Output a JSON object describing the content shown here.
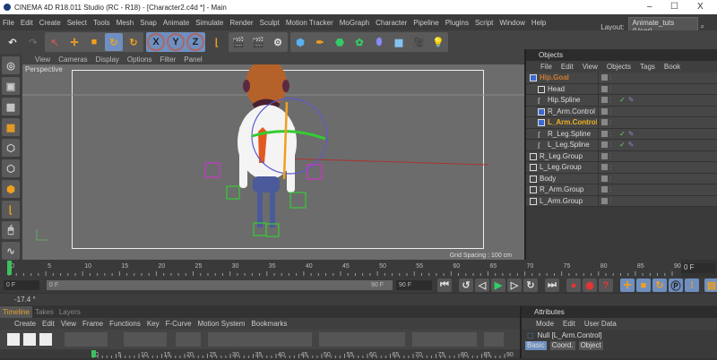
{
  "window": {
    "title": "CINEMA 4D R18.011 Studio (RC - R18) - [Character2.c4d *] - Main",
    "minimize": "–",
    "maximize": "☐",
    "close": "X"
  },
  "menu": [
    "File",
    "Edit",
    "Create",
    "Select",
    "Tools",
    "Mesh",
    "Snap",
    "Animate",
    "Simulate",
    "Render",
    "Sculpt",
    "Motion Tracker",
    "MoGraph",
    "Character",
    "Pipeline",
    "Plugins",
    "Script",
    "Window",
    "Help"
  ],
  "layout": {
    "label": "Layout:",
    "value": "Animate_tuts (User)"
  },
  "toolbar": {
    "icons": [
      "undo-icon",
      "redo-icon",
      "live-selection-icon",
      "move-icon",
      "scale-icon",
      "rotate-icon",
      "recent-tool-icon",
      "x-axis-icon",
      "y-axis-icon",
      "z-axis-icon",
      "coordinate-system-icon",
      "render-view-icon",
      "render-picture-viewer-icon",
      "render-settings-icon",
      "cube-icon",
      "pen-icon",
      "subdivision-icon",
      "cloner-icon",
      "deformer-icon",
      "floor-icon",
      "camera-icon",
      "light-icon"
    ],
    "axis_labels": [
      "X",
      "Y",
      "Z"
    ]
  },
  "viewport": {
    "menu": [
      "View",
      "Cameras",
      "Display",
      "Options",
      "Filter",
      "Panel"
    ],
    "label": "Perspective",
    "grid_spacing": "Grid Spacing : 100 cm"
  },
  "objects": {
    "title": "Objects",
    "menu": [
      "File",
      "Edit",
      "View",
      "Objects",
      "Tags",
      "Book"
    ],
    "items": [
      {
        "name": "Hip.Goal",
        "depth": 0,
        "color": "#d07a30",
        "type": "null",
        "spline_tag": false
      },
      {
        "name": "Head",
        "depth": 1,
        "color": "#dddddd",
        "type": "group",
        "spline_tag": false
      },
      {
        "name": "Hip.Spline",
        "depth": 1,
        "color": "#dddddd",
        "type": "spline",
        "spline_tag": true
      },
      {
        "name": "R_Arm.Control",
        "depth": 1,
        "color": "#dddddd",
        "type": "null",
        "spline_tag": false
      },
      {
        "name": "L_Arm.Control",
        "depth": 1,
        "color": "#f0b020",
        "type": "null",
        "spline_tag": false
      },
      {
        "name": "R_Leg.Spline",
        "depth": 1,
        "color": "#dddddd",
        "type": "spline",
        "spline_tag": true
      },
      {
        "name": "L_Leg.Spline",
        "depth": 1,
        "color": "#dddddd",
        "type": "spline",
        "spline_tag": true
      },
      {
        "name": "R_Leg.Group",
        "depth": 0,
        "color": "#dddddd",
        "type": "group",
        "spline_tag": false
      },
      {
        "name": "L_Leg.Group",
        "depth": 0,
        "color": "#dddddd",
        "type": "group",
        "spline_tag": false
      },
      {
        "name": "Body",
        "depth": 0,
        "color": "#dddddd",
        "type": "group",
        "spline_tag": false
      },
      {
        "name": "R_Arm.Group",
        "depth": 0,
        "color": "#dddddd",
        "type": "group",
        "spline_tag": false
      },
      {
        "name": "L_Arm.Group",
        "depth": 0,
        "color": "#dddddd",
        "type": "group",
        "spline_tag": false
      }
    ]
  },
  "ruler": {
    "ticks": [
      "0",
      "5",
      "10",
      "15",
      "20",
      "25",
      "30",
      "35",
      "40",
      "45",
      "50",
      "55",
      "60",
      "65",
      "70",
      "75",
      "80",
      "85",
      "90"
    ],
    "current_frame": "0 F"
  },
  "transport": {
    "start": "0 F",
    "range_start": "0 F",
    "range_end": "90 F",
    "end": "90 F"
  },
  "status": {
    "value": "-17.4 °"
  },
  "timeline": {
    "tabs": [
      "Timeline",
      "Takes",
      "Layers"
    ],
    "menu": [
      "Create",
      "Edit",
      "View",
      "Frame",
      "Functions",
      "Key",
      "F-Curve",
      "Motion System",
      "Bookmarks"
    ],
    "ticks": [
      "0",
      "5",
      "10",
      "15",
      "20",
      "25",
      "30",
      "35",
      "40",
      "45",
      "50",
      "55",
      "60",
      "65",
      "70",
      "75",
      "80",
      "85",
      "90"
    ]
  },
  "attributes": {
    "title": "Attributes",
    "menu": [
      "Mode",
      "Edit",
      "User Data"
    ],
    "object": "Null [L_Arm.Control]",
    "tabs": [
      "Basic",
      "Coord.",
      "Object"
    ]
  },
  "colors": {
    "accent": "#6f8fc0",
    "selected_object": "#f0b020",
    "timeline_tab": "#e0a030",
    "playhead": "#3cc060"
  }
}
